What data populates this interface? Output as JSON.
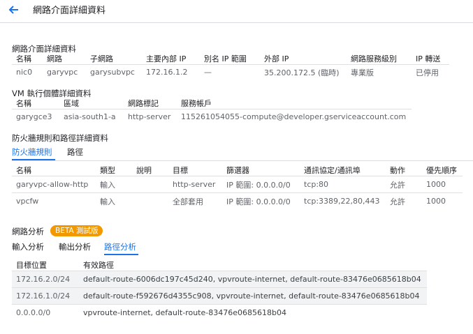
{
  "header": {
    "title": "網路介面詳細資料"
  },
  "nic_section": {
    "title": "網路介面詳細資料",
    "columns": [
      "名稱",
      "網路",
      "子網路",
      "主要內部 IP",
      "別名 IP 範圍",
      "外部 IP",
      "網路服務級別",
      "IP 轉送"
    ],
    "rows": [
      [
        "nic0",
        "garyvpc",
        "garysubvpc",
        "172.16.1.2",
        "—",
        "35.200.172.5 (臨時)",
        "專業版",
        "已停用"
      ]
    ]
  },
  "vm_section": {
    "title": "VM 執行個體詳細資料",
    "columns": [
      "名稱",
      "區域",
      "網路標記",
      "服務帳戶"
    ],
    "rows": [
      [
        "garygce3",
        "asia-south1-a",
        "http-server",
        "115261054055-compute@developer.gserviceaccount.com"
      ]
    ]
  },
  "firewall_section": {
    "title": "防火牆規則和路徑詳細資料",
    "tabs": [
      "防火牆規則",
      "路徑"
    ],
    "columns": [
      "名稱",
      "類型",
      "說明",
      "目標",
      "篩選器",
      "通訊協定/通訊埠",
      "動作",
      "優先順序"
    ],
    "rows": [
      [
        "garyvpc-allow-http",
        "輸入",
        "",
        "http-server",
        "IP 範圍: 0.0.0.0/0",
        "tcp:80",
        "允許",
        "1000"
      ],
      [
        "vpcfw",
        "輸入",
        "",
        "全部套用",
        "IP 範圍: 0.0.0.0/0",
        "tcp:3389,22,80,443",
        "允許",
        "1000"
      ]
    ]
  },
  "analysis_section": {
    "title": "網路分析",
    "badge": "BETA 測試版",
    "tabs": [
      "輸入分析",
      "輸出分析",
      "路徑分析"
    ],
    "columns": [
      "目標位置",
      "有效路徑"
    ],
    "rows": [
      [
        "172.16.2.0/24",
        "default-route-6006dc197c45d240, vpvroute-internet, default-route-83476e0685618b04"
      ],
      [
        "172.16.1.0/24",
        "default-route-f592676d4355c908, vpvroute-internet, default-route-83476e0685618b04"
      ],
      [
        "0.0.0.0/0",
        "vpvroute-internet, default-route-83476e0685618b04"
      ]
    ]
  },
  "colors": {
    "accent": "#1a73e8",
    "badge": "#f29900",
    "row_alt": "#f1f3f4"
  },
  "icons": {
    "back": "arrow-back-icon"
  }
}
